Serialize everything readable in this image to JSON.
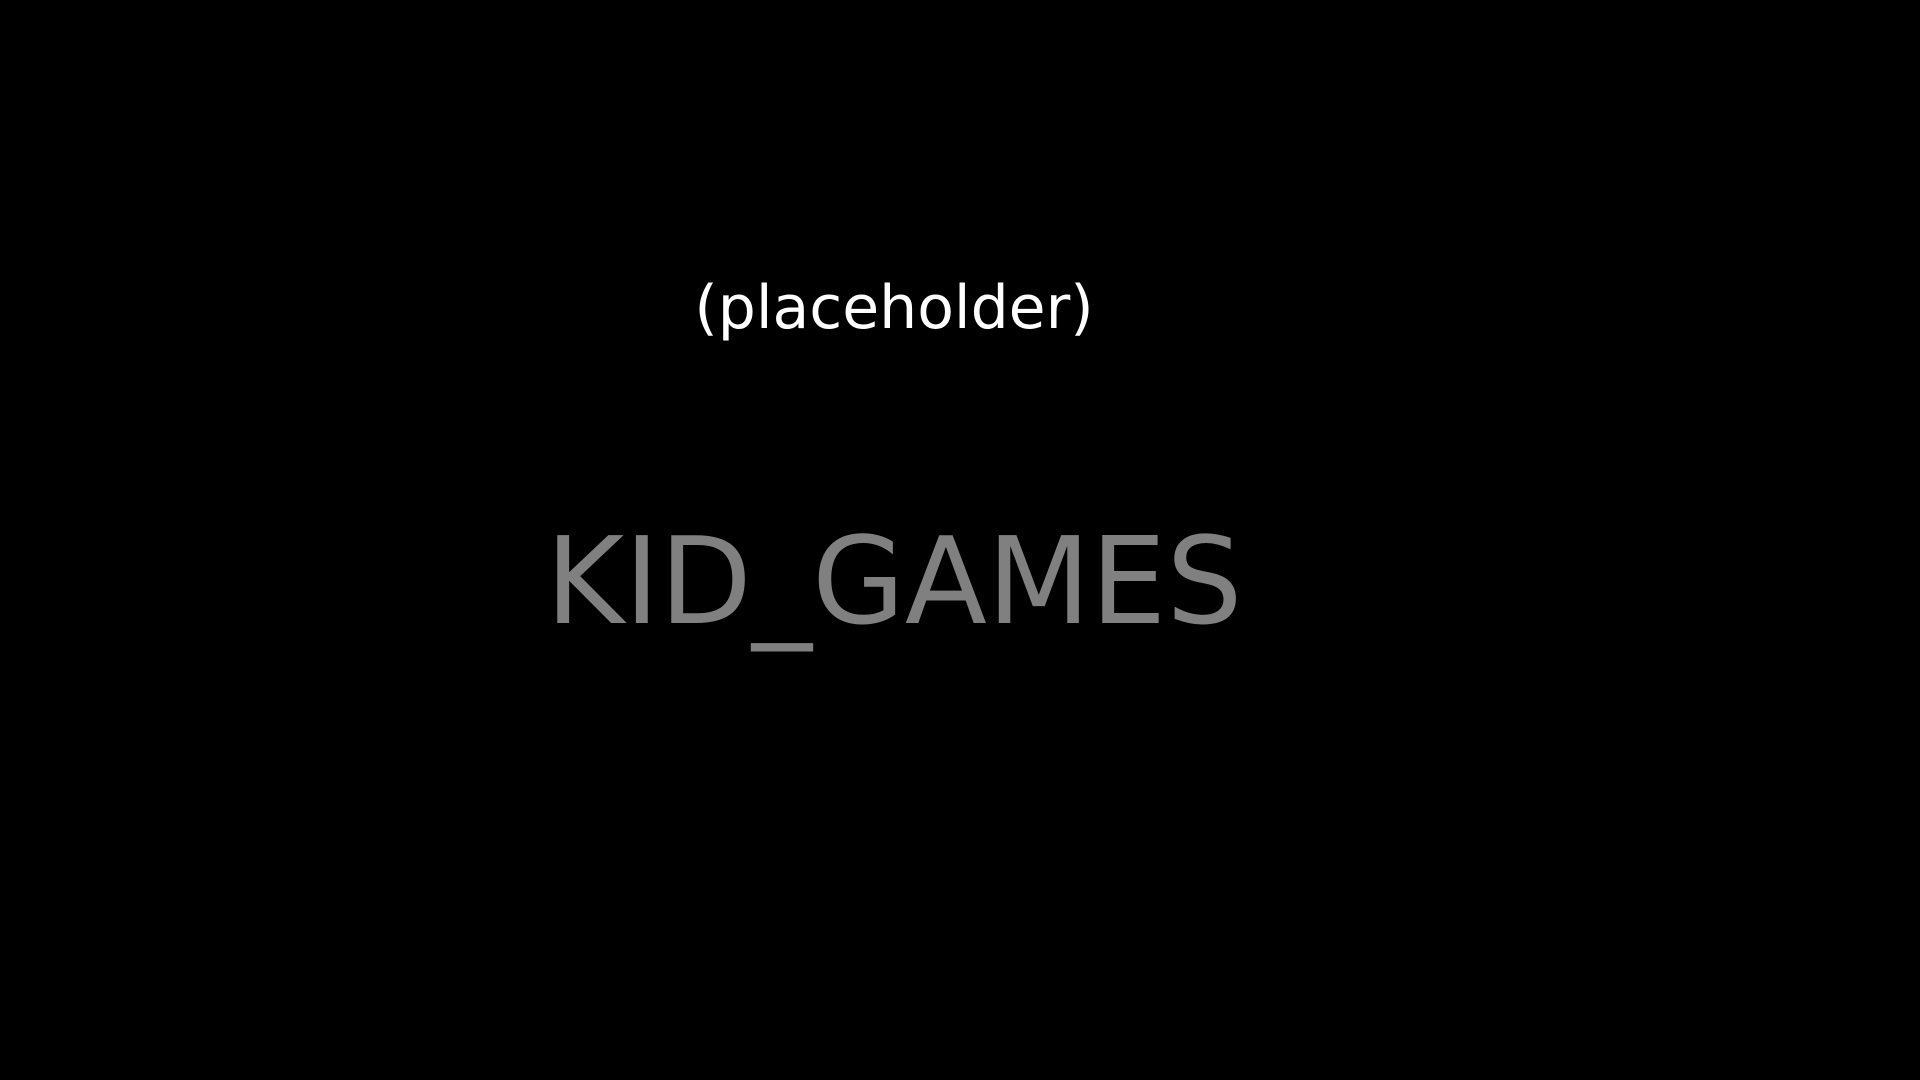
{
  "screen": {
    "placeholder_label": "(placeholder)",
    "title": "KID_GAMES"
  },
  "colors": {
    "background": "#000000",
    "placeholder_text": "#ffffff",
    "title_text": "#808080"
  }
}
